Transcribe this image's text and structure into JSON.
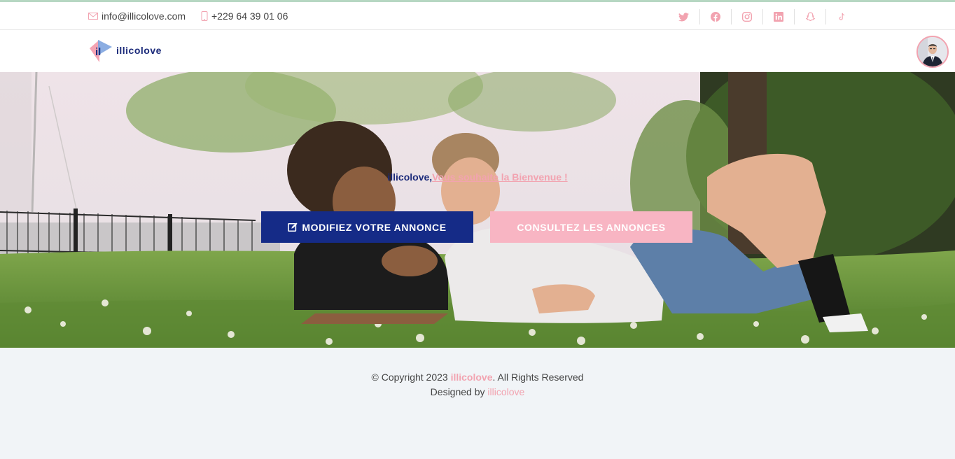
{
  "topbar": {
    "email": "info@illicolove.com",
    "phone": "+229 64 39 01 06",
    "socials": [
      "twitter-icon",
      "facebook-icon",
      "instagram-icon",
      "linkedin-icon",
      "snapchat-icon",
      "tiktok-icon"
    ]
  },
  "header": {
    "logo_mark": "il",
    "logo_text": "illicolove"
  },
  "hero": {
    "tagline_brand": "illicolove,",
    "tagline_welcome": "Vous souhaite la Bienvenue !",
    "btn_edit": "MODIFIEZ VOTRE ANNONCE",
    "btn_browse": "CONSULTEZ LES ANNONCES"
  },
  "footer": {
    "copy_prefix": "© Copyright 2023 ",
    "copy_brand": "illicolove",
    "copy_suffix": ". All Rights Reserved",
    "designed_prefix": "Designed by ",
    "designed_brand": "illicolove"
  },
  "colors": {
    "brand_blue": "#152b87",
    "brand_pink": "#f2a3b0",
    "button_pink": "#f8b5c3"
  }
}
